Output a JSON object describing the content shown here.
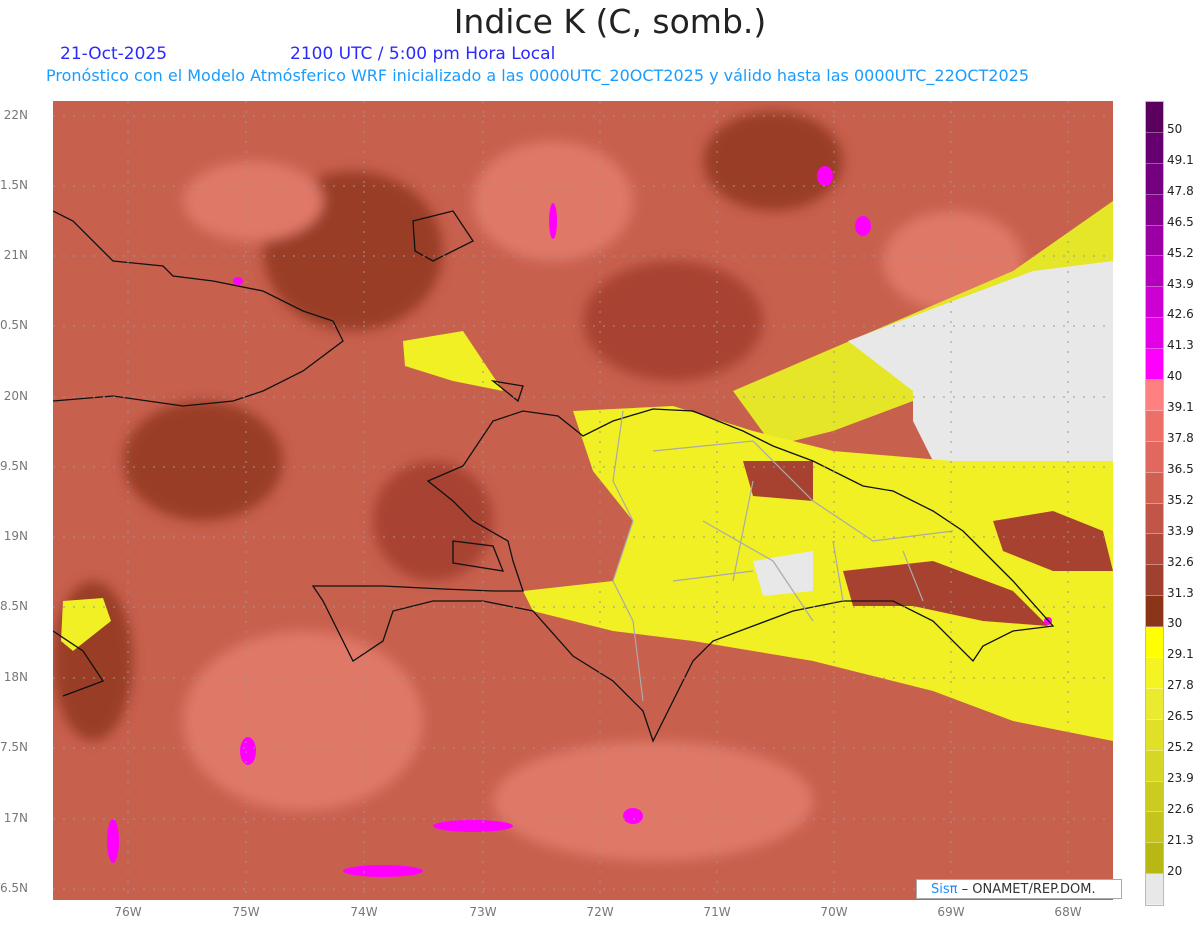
{
  "header": {
    "title": "Indice K (C, somb.)",
    "date": "21-Oct-2025",
    "time": "2100 UTC / 5:00 pm Hora Local",
    "subtitle": "Pronóstico con el Modelo Atmósferico WRF inicializado a las 0000UTC_20OCT2025 y válido hasta las  0000UTC_22OCT2025"
  },
  "map": {
    "lat_labels": [
      "22N",
      "1.5N",
      "21N",
      "0.5N",
      "20N",
      "9.5N",
      "19N",
      "8.5N",
      "18N",
      "7.5N",
      "17N",
      "6.5N"
    ],
    "lon_labels": [
      "76W",
      "75W",
      "74W",
      "73W",
      "72W",
      "71W",
      "70W",
      "69W",
      "68W"
    ]
  },
  "colorbar": {
    "labels": [
      "50",
      "49.1",
      "47.8",
      "46.5",
      "45.2",
      "43.9",
      "42.6",
      "41.3",
      "40",
      "39.1",
      "37.8",
      "36.5",
      "35.2",
      "33.9",
      "32.6",
      "31.3",
      "30",
      "29.1",
      "27.8",
      "26.5",
      "25.2",
      "23.9",
      "22.6",
      "21.3",
      "20"
    ],
    "colors": [
      "#5a005e",
      "#660070",
      "#740080",
      "#86008e",
      "#9a00a4",
      "#b400bc",
      "#cc00d2",
      "#e200e6",
      "#ff00ff",
      "#ff8080",
      "#ec7068",
      "#e0685e",
      "#d06050",
      "#c05548",
      "#b04a3c",
      "#a04030",
      "#8a3418",
      "#ffff00",
      "#f4f422",
      "#eaea30",
      "#e0e028",
      "#d6d624",
      "#cccc20",
      "#c4c41c",
      "#b8b814",
      "#e8e8e8"
    ]
  },
  "credit": {
    "brand": "Sisπ",
    "text": "– ONAMET/REP.DOM."
  }
}
